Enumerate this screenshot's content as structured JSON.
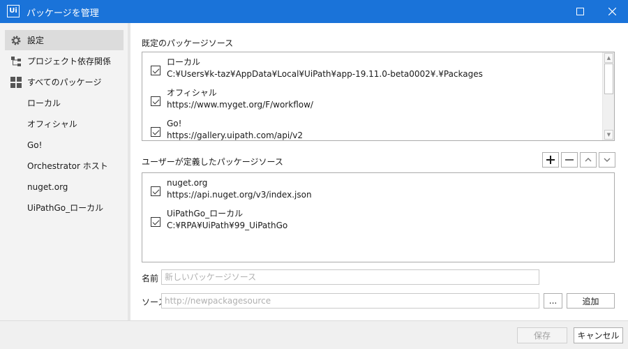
{
  "window": {
    "logo": "Ui",
    "title": "パッケージを管理"
  },
  "sidebar": {
    "items": [
      {
        "label": "設定",
        "icon": "gear-icon"
      },
      {
        "label": "プロジェクト依存関係",
        "icon": "tree-icon"
      },
      {
        "label": "すべてのパッケージ",
        "icon": "grid-icon"
      },
      {
        "label": "ローカル"
      },
      {
        "label": "オフィシャル"
      },
      {
        "label": "Go!"
      },
      {
        "label": "Orchestrator ホスト"
      },
      {
        "label": "nuget.org"
      },
      {
        "label": "UiPathGo_ローカル"
      }
    ]
  },
  "default_sources": {
    "heading": "既定のパッケージソース",
    "items": [
      {
        "name": "ローカル",
        "url": "C:¥Users¥k-taz¥AppData¥Local¥UiPath¥app-19.11.0-beta0002¥.¥Packages",
        "checked": true
      },
      {
        "name": "オフィシャル",
        "url": "https://www.myget.org/F/workflow/",
        "checked": true
      },
      {
        "name": "Go!",
        "url": "https://gallery.uipath.com/api/v2",
        "checked": true
      }
    ]
  },
  "user_sources": {
    "heading": "ユーザーが定義したパッケージソース",
    "items": [
      {
        "name": "nuget.org",
        "url": "https://api.nuget.org/v3/index.json",
        "checked": true
      },
      {
        "name": "UiPathGo_ローカル",
        "url": "C:¥RPA¥UiPath¥99_UiPathGo",
        "checked": true
      }
    ]
  },
  "form": {
    "name_label": "名前",
    "name_placeholder": "新しいパッケージソース",
    "source_label": "ソース",
    "source_placeholder": "http://newpackagesource",
    "browse_label": "...",
    "add_label": "追加"
  },
  "footer": {
    "save_label": "保存",
    "cancel_label": "キャンセル"
  }
}
